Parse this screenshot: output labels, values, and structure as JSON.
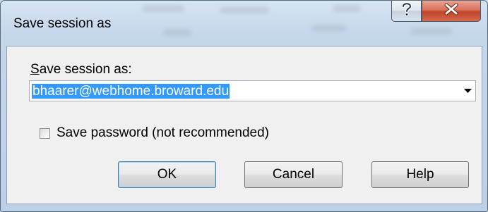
{
  "window": {
    "title": "Save session as"
  },
  "caption_buttons": {
    "help_icon": "question-mark-icon",
    "close_icon": "close-x-icon"
  },
  "form": {
    "label": "Save session as:",
    "session_name_value": "bhaarer@webhome.broward.edu",
    "session_name_selected": true,
    "dropdown_icon": "dropdown-arrow-icon",
    "save_password_label": "Save password (not recommended)",
    "save_password_checked": false
  },
  "buttons": {
    "ok_label": "OK",
    "cancel_label": "Cancel",
    "help_label": "Help"
  },
  "colors": {
    "selection": "#3399ff",
    "close_button": "#c0442a",
    "frame": "#bcd0e6"
  }
}
